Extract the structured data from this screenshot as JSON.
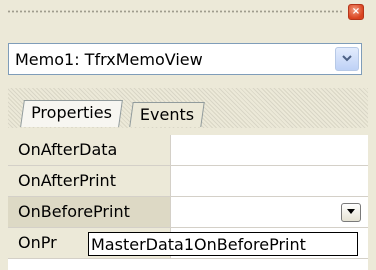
{
  "window": {
    "close_icon": "×"
  },
  "object_selector": {
    "value": "Memo1: TfrxMemoView",
    "arrow_icon": "chevron-down"
  },
  "tabs": [
    {
      "label": "Properties",
      "active": true
    },
    {
      "label": "Events",
      "active": false
    }
  ],
  "events": [
    {
      "name": "OnAfterData",
      "value": ""
    },
    {
      "name": "OnAfterPrint",
      "value": ""
    },
    {
      "name": "OnBeforePrint",
      "value": "",
      "selected": true
    },
    {
      "name": "OnPr",
      "value": ""
    }
  ],
  "dropdown": {
    "option": "MasterData1OnBeforePrint"
  }
}
